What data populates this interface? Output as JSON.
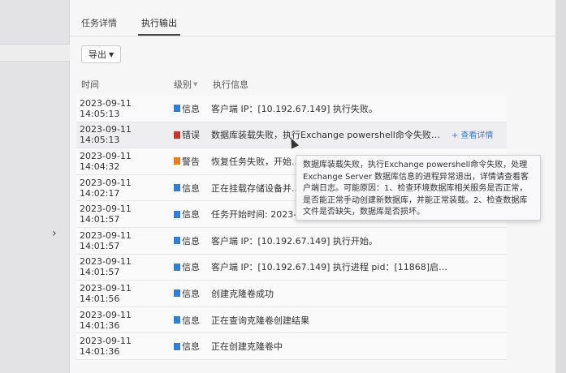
{
  "tabs": [
    {
      "label": "任务详情",
      "active": false
    },
    {
      "label": "执行输出",
      "active": true
    }
  ],
  "toolbar": {
    "export_label": "导出"
  },
  "table": {
    "columns": [
      "时间",
      "级别",
      "执行信息"
    ],
    "rows": [
      {
        "time": "2023-09-11 14:05:13",
        "level": "信息",
        "color": "#2f7fd6",
        "info": "客户端 IP：[10.192.67.149] 执行失败。"
      },
      {
        "time": "2023-09-11 14:05:13",
        "level": "错误",
        "color": "#c0392b",
        "info": "数据库装载失败，执行Exchange powershell命令失败…",
        "link": "+ 查看详情"
      },
      {
        "time": "2023-09-11 14:04:32",
        "level": "警告",
        "color": "#e67e22",
        "info": "恢复任务失败，开始..."
      },
      {
        "time": "2023-09-11 14:02:17",
        "level": "信息",
        "color": "#2f7fd6",
        "info": "正在挂载存储设备并..."
      },
      {
        "time": "2023-09-11 14:01:57",
        "level": "信息",
        "color": "#2f7fd6",
        "info": "任务开始时间: 2023-09-11 14:01:57"
      },
      {
        "time": "2023-09-11 14:01:57",
        "level": "信息",
        "color": "#2f7fd6",
        "info": "客户端 IP：[10.192.67.149] 执行开始。"
      },
      {
        "time": "2023-09-11 14:01:57",
        "level": "信息",
        "color": "#2f7fd6",
        "info": "客户端 IP：[10.192.67.149] 执行进程 pid：[11868]启…"
      },
      {
        "time": "2023-09-11 14:01:56",
        "level": "信息",
        "color": "#2f7fd6",
        "info": "创建克隆卷成功"
      },
      {
        "time": "2023-09-11 14:01:36",
        "level": "信息",
        "color": "#2f7fd6",
        "info": "正在查询克隆卷创建结果"
      },
      {
        "time": "2023-09-11 14:01:36",
        "level": "信息",
        "color": "#2f7fd6",
        "info": "正在创建克隆卷中"
      }
    ]
  },
  "tooltip": {
    "text": "数据库装载失败，执行Exchange powershell命令失败，处理Exchange Server 数据库信息的进程异常退出，详情请查看客户端日志。可能原因：1、检查环境数据库相关服务是否正常，是否能正常手动创建新数据库，并能正常装载。2、检查数据库文件是否缺失，数据库是否损坏。"
  }
}
